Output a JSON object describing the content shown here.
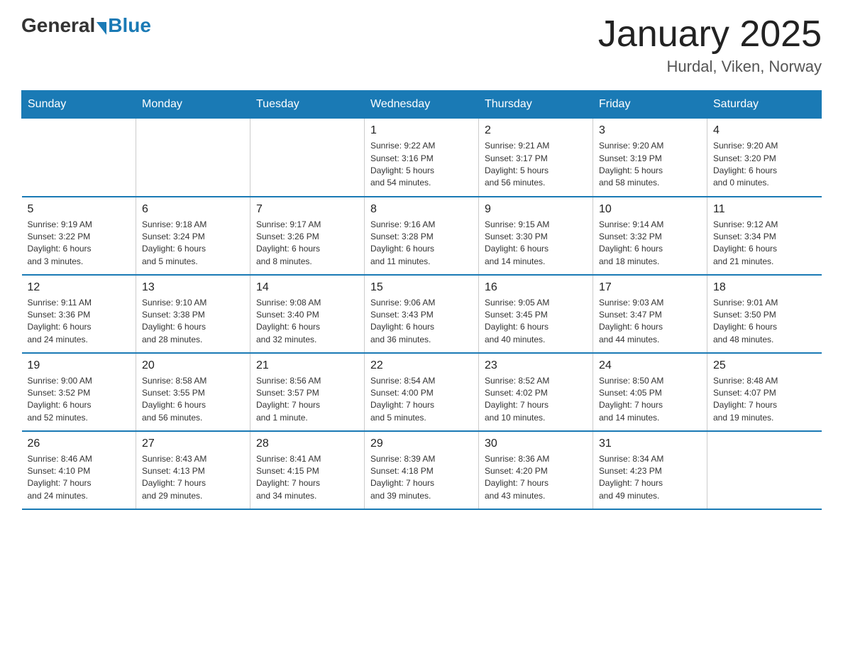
{
  "header": {
    "logo_general": "General",
    "logo_blue": "Blue",
    "month_title": "January 2025",
    "location": "Hurdal, Viken, Norway"
  },
  "weekdays": [
    "Sunday",
    "Monday",
    "Tuesday",
    "Wednesday",
    "Thursday",
    "Friday",
    "Saturday"
  ],
  "weeks": [
    [
      {
        "day": "",
        "info": ""
      },
      {
        "day": "",
        "info": ""
      },
      {
        "day": "",
        "info": ""
      },
      {
        "day": "1",
        "info": "Sunrise: 9:22 AM\nSunset: 3:16 PM\nDaylight: 5 hours\nand 54 minutes."
      },
      {
        "day": "2",
        "info": "Sunrise: 9:21 AM\nSunset: 3:17 PM\nDaylight: 5 hours\nand 56 minutes."
      },
      {
        "day": "3",
        "info": "Sunrise: 9:20 AM\nSunset: 3:19 PM\nDaylight: 5 hours\nand 58 minutes."
      },
      {
        "day": "4",
        "info": "Sunrise: 9:20 AM\nSunset: 3:20 PM\nDaylight: 6 hours\nand 0 minutes."
      }
    ],
    [
      {
        "day": "5",
        "info": "Sunrise: 9:19 AM\nSunset: 3:22 PM\nDaylight: 6 hours\nand 3 minutes."
      },
      {
        "day": "6",
        "info": "Sunrise: 9:18 AM\nSunset: 3:24 PM\nDaylight: 6 hours\nand 5 minutes."
      },
      {
        "day": "7",
        "info": "Sunrise: 9:17 AM\nSunset: 3:26 PM\nDaylight: 6 hours\nand 8 minutes."
      },
      {
        "day": "8",
        "info": "Sunrise: 9:16 AM\nSunset: 3:28 PM\nDaylight: 6 hours\nand 11 minutes."
      },
      {
        "day": "9",
        "info": "Sunrise: 9:15 AM\nSunset: 3:30 PM\nDaylight: 6 hours\nand 14 minutes."
      },
      {
        "day": "10",
        "info": "Sunrise: 9:14 AM\nSunset: 3:32 PM\nDaylight: 6 hours\nand 18 minutes."
      },
      {
        "day": "11",
        "info": "Sunrise: 9:12 AM\nSunset: 3:34 PM\nDaylight: 6 hours\nand 21 minutes."
      }
    ],
    [
      {
        "day": "12",
        "info": "Sunrise: 9:11 AM\nSunset: 3:36 PM\nDaylight: 6 hours\nand 24 minutes."
      },
      {
        "day": "13",
        "info": "Sunrise: 9:10 AM\nSunset: 3:38 PM\nDaylight: 6 hours\nand 28 minutes."
      },
      {
        "day": "14",
        "info": "Sunrise: 9:08 AM\nSunset: 3:40 PM\nDaylight: 6 hours\nand 32 minutes."
      },
      {
        "day": "15",
        "info": "Sunrise: 9:06 AM\nSunset: 3:43 PM\nDaylight: 6 hours\nand 36 minutes."
      },
      {
        "day": "16",
        "info": "Sunrise: 9:05 AM\nSunset: 3:45 PM\nDaylight: 6 hours\nand 40 minutes."
      },
      {
        "day": "17",
        "info": "Sunrise: 9:03 AM\nSunset: 3:47 PM\nDaylight: 6 hours\nand 44 minutes."
      },
      {
        "day": "18",
        "info": "Sunrise: 9:01 AM\nSunset: 3:50 PM\nDaylight: 6 hours\nand 48 minutes."
      }
    ],
    [
      {
        "day": "19",
        "info": "Sunrise: 9:00 AM\nSunset: 3:52 PM\nDaylight: 6 hours\nand 52 minutes."
      },
      {
        "day": "20",
        "info": "Sunrise: 8:58 AM\nSunset: 3:55 PM\nDaylight: 6 hours\nand 56 minutes."
      },
      {
        "day": "21",
        "info": "Sunrise: 8:56 AM\nSunset: 3:57 PM\nDaylight: 7 hours\nand 1 minute."
      },
      {
        "day": "22",
        "info": "Sunrise: 8:54 AM\nSunset: 4:00 PM\nDaylight: 7 hours\nand 5 minutes."
      },
      {
        "day": "23",
        "info": "Sunrise: 8:52 AM\nSunset: 4:02 PM\nDaylight: 7 hours\nand 10 minutes."
      },
      {
        "day": "24",
        "info": "Sunrise: 8:50 AM\nSunset: 4:05 PM\nDaylight: 7 hours\nand 14 minutes."
      },
      {
        "day": "25",
        "info": "Sunrise: 8:48 AM\nSunset: 4:07 PM\nDaylight: 7 hours\nand 19 minutes."
      }
    ],
    [
      {
        "day": "26",
        "info": "Sunrise: 8:46 AM\nSunset: 4:10 PM\nDaylight: 7 hours\nand 24 minutes."
      },
      {
        "day": "27",
        "info": "Sunrise: 8:43 AM\nSunset: 4:13 PM\nDaylight: 7 hours\nand 29 minutes."
      },
      {
        "day": "28",
        "info": "Sunrise: 8:41 AM\nSunset: 4:15 PM\nDaylight: 7 hours\nand 34 minutes."
      },
      {
        "day": "29",
        "info": "Sunrise: 8:39 AM\nSunset: 4:18 PM\nDaylight: 7 hours\nand 39 minutes."
      },
      {
        "day": "30",
        "info": "Sunrise: 8:36 AM\nSunset: 4:20 PM\nDaylight: 7 hours\nand 43 minutes."
      },
      {
        "day": "31",
        "info": "Sunrise: 8:34 AM\nSunset: 4:23 PM\nDaylight: 7 hours\nand 49 minutes."
      },
      {
        "day": "",
        "info": ""
      }
    ]
  ]
}
